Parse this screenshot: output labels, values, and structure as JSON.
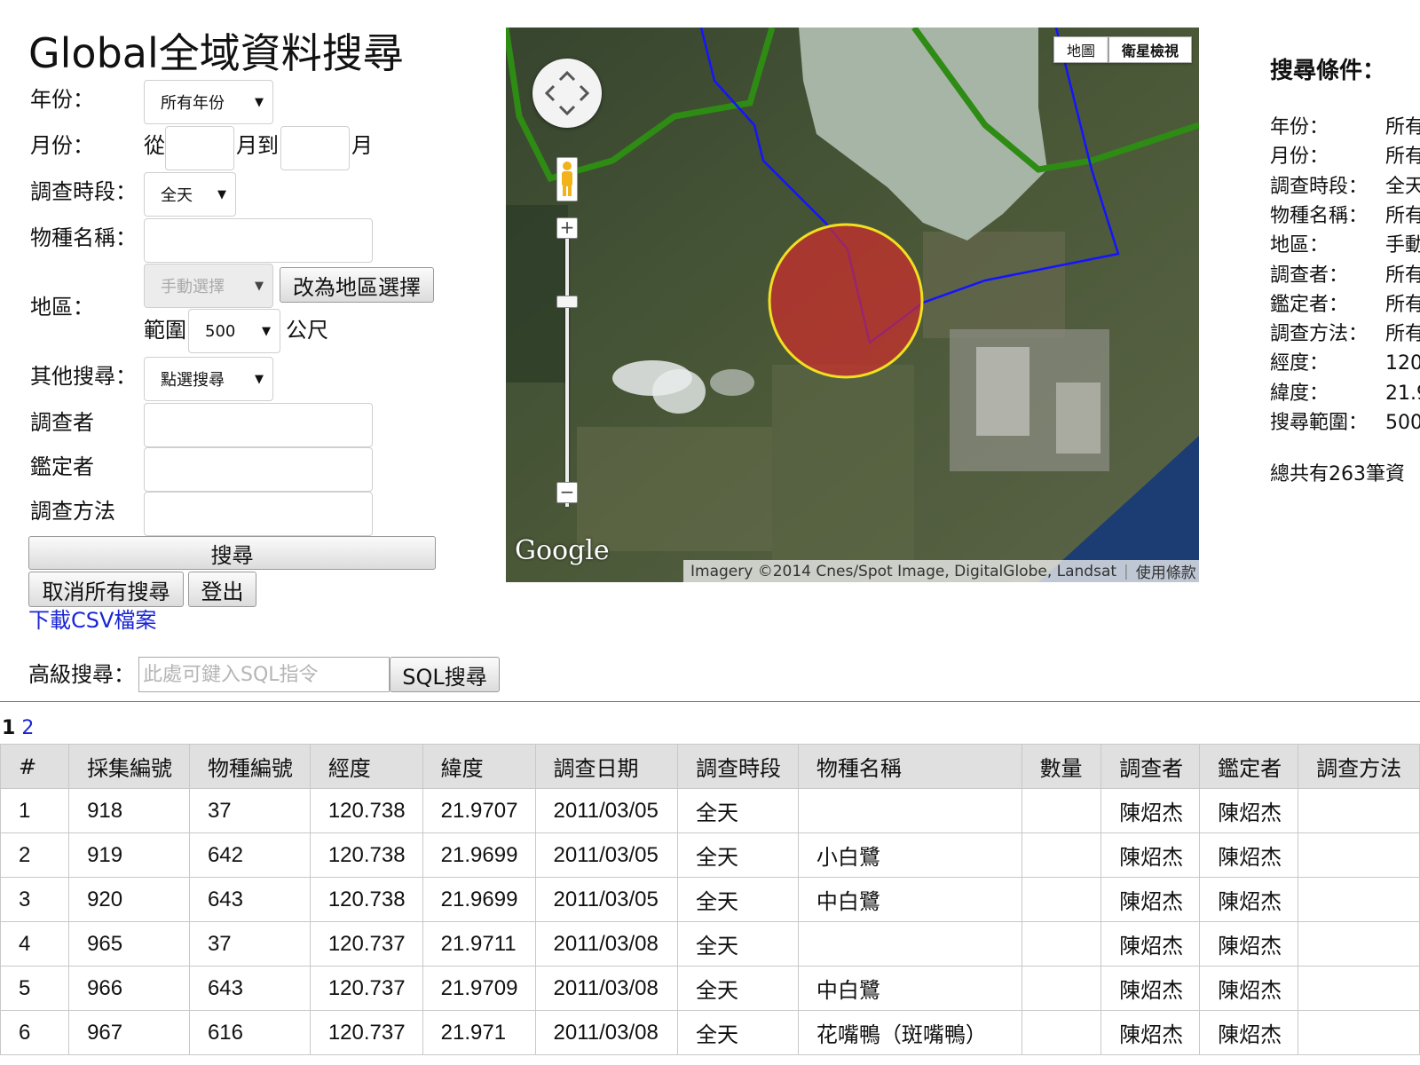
{
  "title": "Global全域資料搜尋",
  "form": {
    "year_label": "年份：",
    "year_value": "所有年份",
    "month_label": "月份：",
    "month_from": "從",
    "month_to": "月到",
    "month_suffix": "月",
    "month_from_value": "",
    "month_to_value": "",
    "period_label": "調查時段：",
    "period_value": "全天",
    "species_label": "物種名稱：",
    "species_value": "",
    "region_label": "地區：",
    "region_value": "手動選擇",
    "region_toggle_button": "改為地區選擇",
    "range_label": "範圍",
    "range_value": "500",
    "range_unit": "公尺",
    "other_label": "其他搜尋：",
    "other_value": "點選搜尋",
    "surveyor_label": "調查者",
    "surveyor_value": "",
    "identifier_label": "鑑定者",
    "identifier_value": "",
    "method_label": "調查方法",
    "method_value": "",
    "search_button": "搜尋",
    "cancel_button": "取消所有搜尋",
    "logout_button": "登出",
    "csv_link": "下載CSV檔案"
  },
  "map": {
    "type_map": "地圖",
    "type_satellite": "衛星檢視",
    "logo": "Google",
    "attribution": "Imagery ©2014 Cnes/Spot Image, DigitalGlobe, Landsat",
    "terms": "使用條款",
    "colors": {
      "boundary_green": "#2e8b14",
      "boundary_blue": "#1414ff",
      "circle_fill": "#d12c2c",
      "circle_stroke": "#f0e020"
    }
  },
  "summary": {
    "heading": "搜尋條件：",
    "rows": [
      {
        "key": "年份：",
        "value": "所有"
      },
      {
        "key": "月份：",
        "value": "所有"
      },
      {
        "key": "調查時段：",
        "value": "全天"
      },
      {
        "key": "物種名稱：",
        "value": "所有"
      },
      {
        "key": "地區：",
        "value": "手動"
      },
      {
        "key": "調查者：",
        "value": "所有"
      },
      {
        "key": "鑑定者：",
        "value": "所有"
      },
      {
        "key": "調查方法：",
        "value": "所有"
      },
      {
        "key": "經度：",
        "value": "120"
      },
      {
        "key": "緯度：",
        "value": "21.9"
      },
      {
        "key": "搜尋範圍：",
        "value": "500"
      }
    ],
    "total": "總共有263筆資"
  },
  "advanced": {
    "label": "高級搜尋：",
    "placeholder": "此處可鍵入SQL指令",
    "value": "",
    "button": "SQL搜尋"
  },
  "pagination": {
    "current": "1",
    "pages": [
      "2"
    ]
  },
  "table": {
    "headers": [
      "#",
      "採集編號",
      "物種編號",
      "經度",
      "緯度",
      "調查日期",
      "調查時段",
      "物種名稱",
      "數量",
      "調查者",
      "鑑定者",
      "調查方法"
    ],
    "rows": [
      [
        "1",
        "918",
        "37",
        "120.738",
        "21.9707",
        "2011/03/05",
        "全天",
        "",
        "",
        "陳炤杰",
        "陳炤杰",
        ""
      ],
      [
        "2",
        "919",
        "642",
        "120.738",
        "21.9699",
        "2011/03/05",
        "全天",
        "小白鷺",
        "",
        "陳炤杰",
        "陳炤杰",
        ""
      ],
      [
        "3",
        "920",
        "643",
        "120.738",
        "21.9699",
        "2011/03/05",
        "全天",
        "中白鷺",
        "",
        "陳炤杰",
        "陳炤杰",
        ""
      ],
      [
        "4",
        "965",
        "37",
        "120.737",
        "21.9711",
        "2011/03/08",
        "全天",
        "",
        "",
        "陳炤杰",
        "陳炤杰",
        ""
      ],
      [
        "5",
        "966",
        "643",
        "120.737",
        "21.9709",
        "2011/03/08",
        "全天",
        "中白鷺",
        "",
        "陳炤杰",
        "陳炤杰",
        ""
      ],
      [
        "6",
        "967",
        "616",
        "120.737",
        "21.971",
        "2011/03/08",
        "全天",
        "花嘴鴨（斑嘴鴨）",
        "",
        "陳炤杰",
        "陳炤杰",
        ""
      ]
    ]
  }
}
